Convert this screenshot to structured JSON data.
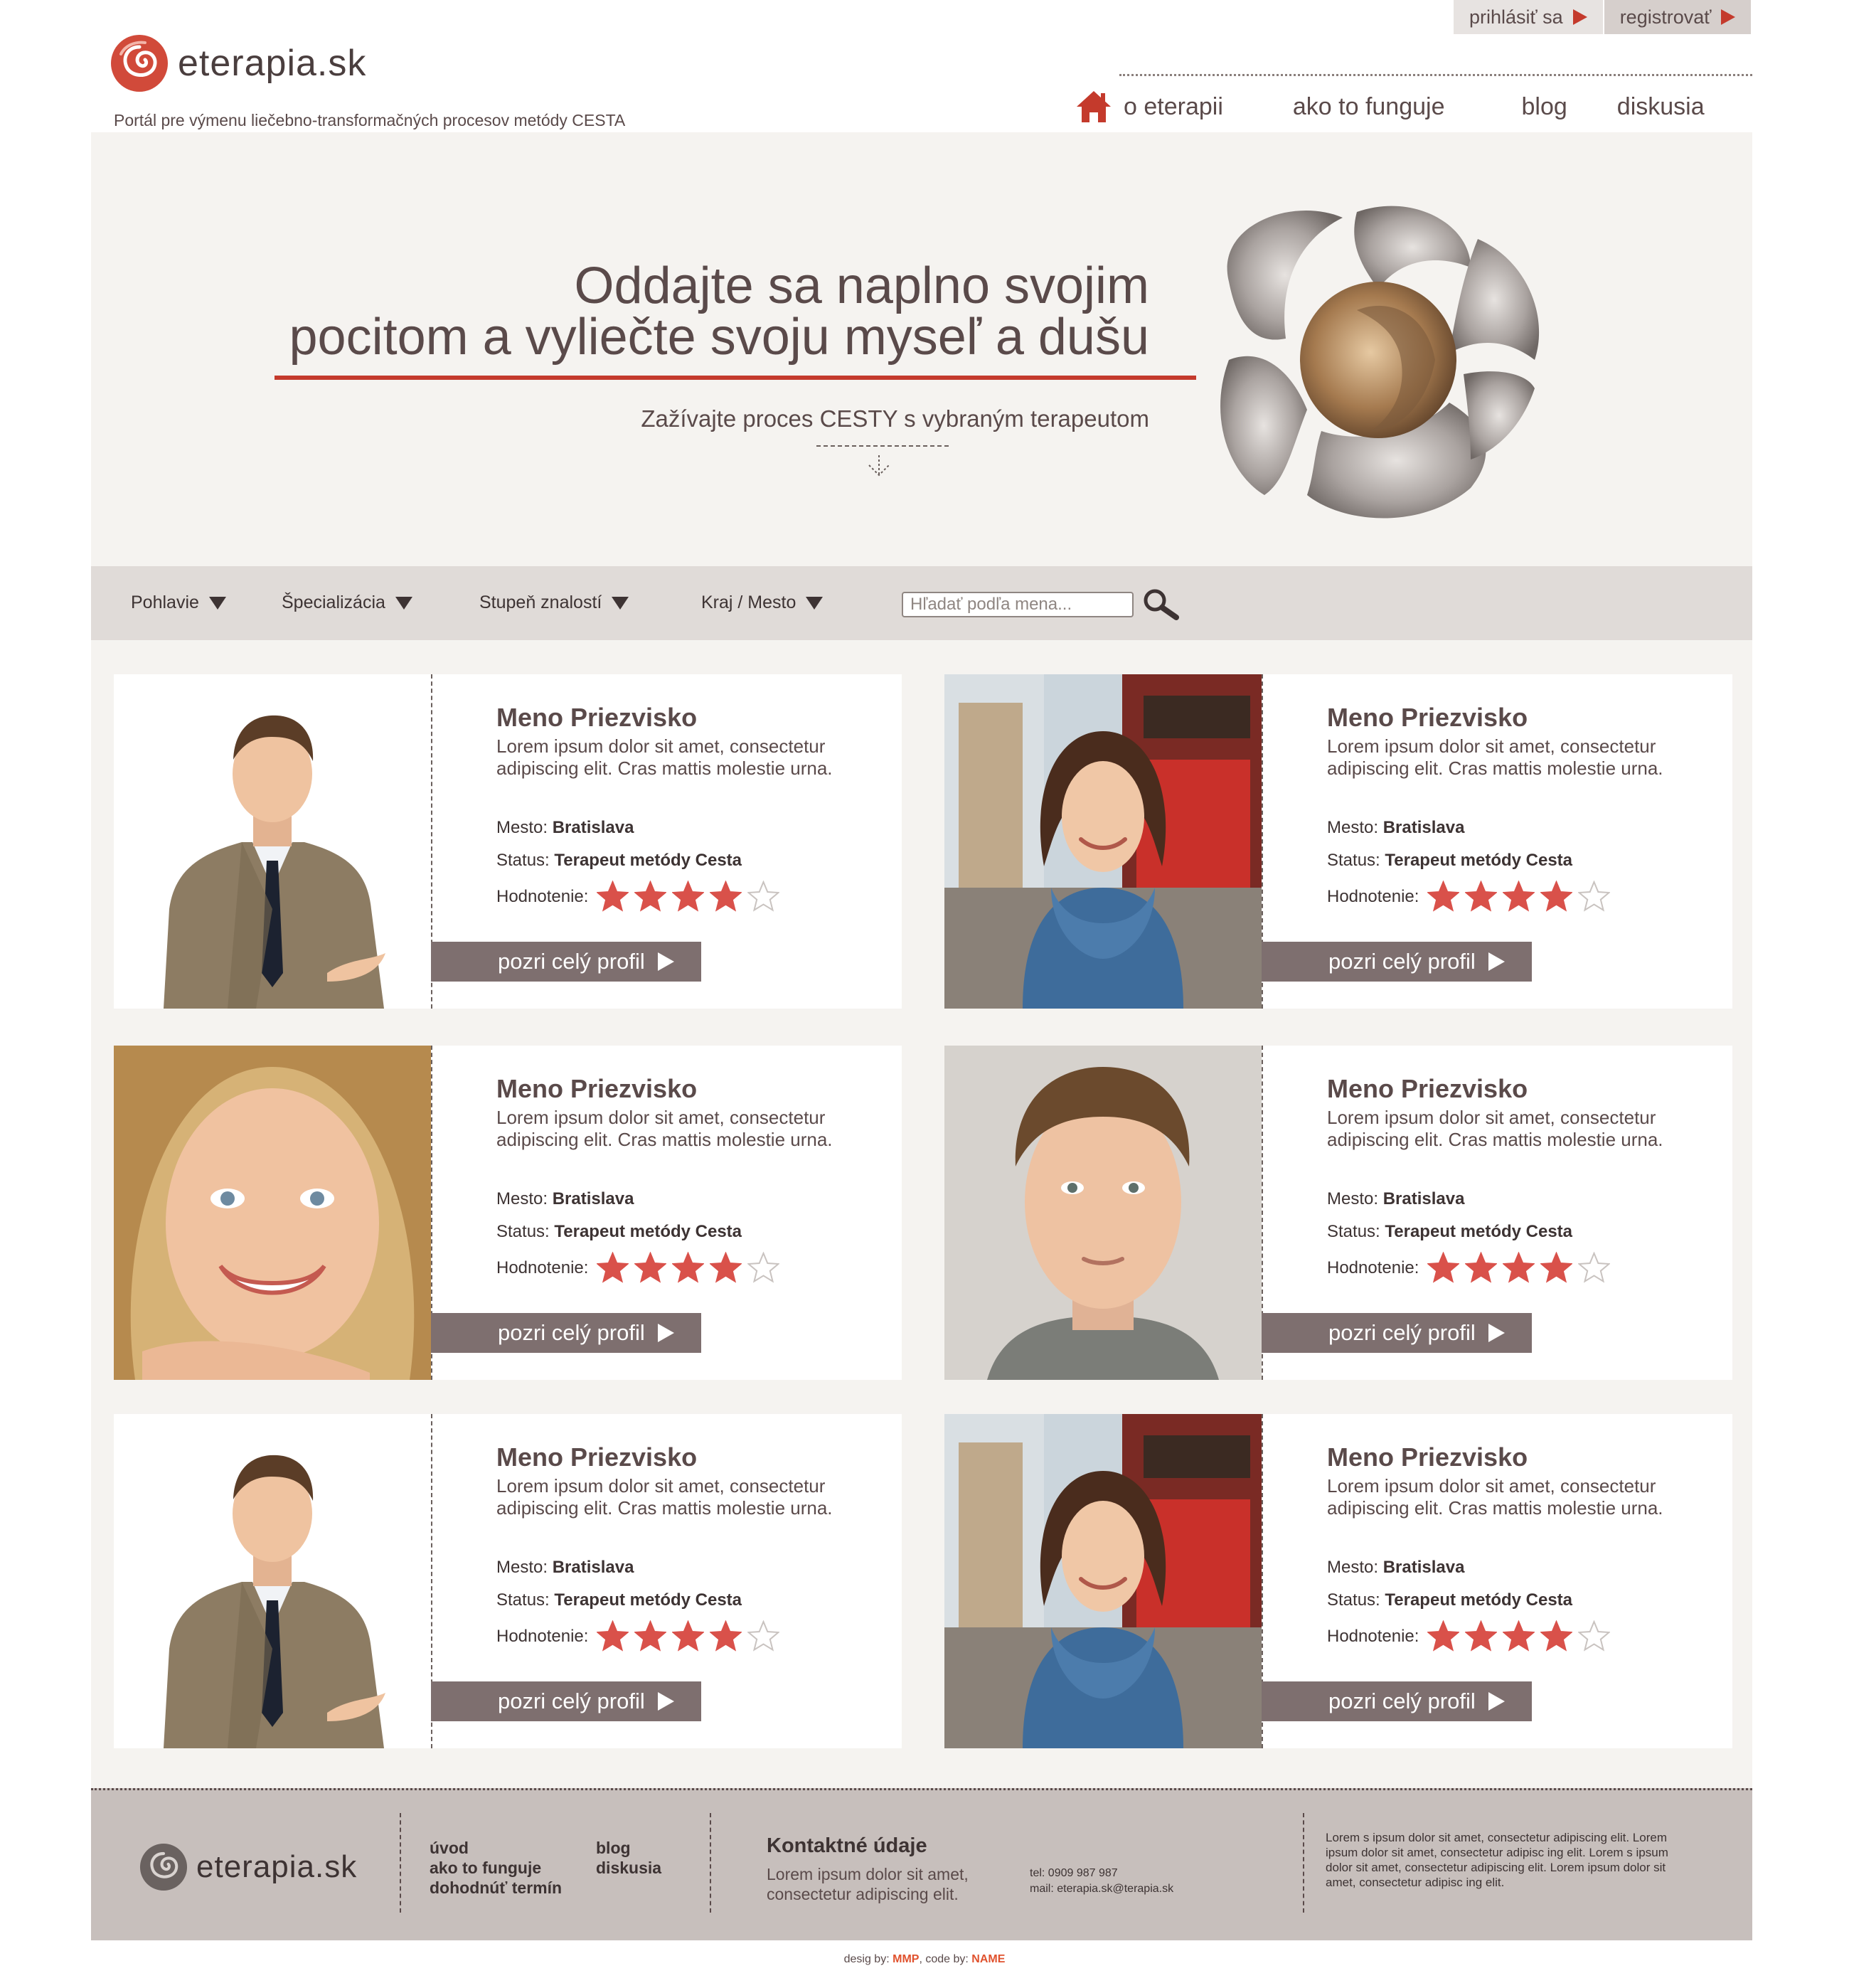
{
  "auth": {
    "login": "prihlásiť sa",
    "register": "registrovať"
  },
  "header": {
    "logo": "eterapia.sk",
    "tagline": "Portál pre výmenu liečebno-transformačných procesov metódy CESTA",
    "nav": [
      "o eterapii",
      "ako to funguje",
      "blog",
      "diskusia"
    ]
  },
  "hero": {
    "line1": "Oddajte sa naplno svojim",
    "line2": "pocitom a vyliečte svoju myseľ a dušu",
    "sub": "Zažívajte proces CESTY s vybraným terapeutom"
  },
  "filters": {
    "items": [
      "Pohlavie",
      "Špecializácia",
      "Stupeň znalostí",
      "Kraj / Mesto"
    ],
    "search_placeholder": "Hľadať podľa mena..."
  },
  "cards": [
    {
      "name": "Meno Priezvisko",
      "desc": "Lorem ipsum dolor sit amet, consectetur adipiscing elit. Cras mattis molestie urna.",
      "city_label": "Mesto:",
      "city": "Bratislava",
      "status_label": "Status:",
      "status": "Terapeut metódy Cesta",
      "rating_label": "Hodnotenie:",
      "rating": 4,
      "rating_max": 5,
      "button": "pozri celý profil",
      "photo": "man-in-suit"
    },
    {
      "name": "Meno Priezvisko",
      "desc": "Lorem ipsum dolor sit amet, consectetur adipiscing elit. Cras mattis molestie urna.",
      "city_label": "Mesto:",
      "city": "Bratislava",
      "status_label": "Status:",
      "status": "Terapeut metódy Cesta",
      "rating_label": "Hodnotenie:",
      "rating": 4,
      "rating_max": 5,
      "button": "pozri celý profil",
      "photo": "woman-street"
    },
    {
      "name": "Meno Priezvisko",
      "desc": "Lorem ipsum dolor sit amet, consectetur adipiscing elit. Cras mattis molestie urna.",
      "city_label": "Mesto:",
      "city": "Bratislava",
      "status_label": "Status:",
      "status": "Terapeut metódy Cesta",
      "rating_label": "Hodnotenie:",
      "rating": 4,
      "rating_max": 5,
      "button": "pozri celý profil",
      "photo": "woman-blonde"
    },
    {
      "name": "Meno Priezvisko",
      "desc": "Lorem ipsum dolor sit amet, consectetur adipiscing elit. Cras mattis molestie urna.",
      "city_label": "Mesto:",
      "city": "Bratislava",
      "status_label": "Status:",
      "status": "Terapeut metódy Cesta",
      "rating_label": "Hodnotenie:",
      "rating": 4,
      "rating_max": 5,
      "button": "pozri celý profil",
      "photo": "young-man"
    },
    {
      "name": "Meno Priezvisko",
      "desc": "Lorem ipsum dolor sit amet, consectetur adipiscing elit. Cras mattis molestie urna.",
      "city_label": "Mesto:",
      "city": "Bratislava",
      "status_label": "Status:",
      "status": "Terapeut metódy Cesta",
      "rating_label": "Hodnotenie:",
      "rating": 4,
      "rating_max": 5,
      "button": "pozri celý profil",
      "photo": "man-in-suit"
    },
    {
      "name": "Meno Priezvisko",
      "desc": "Lorem ipsum dolor sit amet, consectetur adipiscing elit. Cras mattis molestie urna.",
      "city_label": "Mesto:",
      "city": "Bratislava",
      "status_label": "Status:",
      "status": "Terapeut metódy Cesta",
      "rating_label": "Hodnotenie:",
      "rating": 4,
      "rating_max": 5,
      "button": "pozri celý profil",
      "photo": "woman-street"
    }
  ],
  "footer": {
    "logo": "eterapia.sk",
    "links_col1": [
      "úvod",
      "ako to funguje",
      "dohodnúť termín"
    ],
    "links_col2": [
      "blog",
      "diskusia"
    ],
    "contact_heading": "Kontaktné údaje",
    "contact_text": "Lorem ipsum dolor sit amet, consectetur adipiscing elit.",
    "tel": "tel:   0909 987 987",
    "mail": "mail: eterapia.sk@terapia.sk",
    "lorem": "Lorem s ipsum dolor sit amet, consectetur adipiscing elit. Lorem ipsum dolor sit amet, consectetur adipisc ing elit. Lorem s ipsum dolor sit amet, consectetur adipiscing elit. Lorem ipsum dolor sit amet, consectetur adipisc ing elit."
  },
  "credit": {
    "prefix": "desig by:",
    "designer": "MMP",
    "mid": ", code by:",
    "coder": "NAME"
  },
  "colors": {
    "accent": "#c43a2c",
    "button": "#7e6f6f",
    "footer": "#c7bfbc",
    "page": "#f5f3f0",
    "star_off": "#d7d2cf"
  }
}
